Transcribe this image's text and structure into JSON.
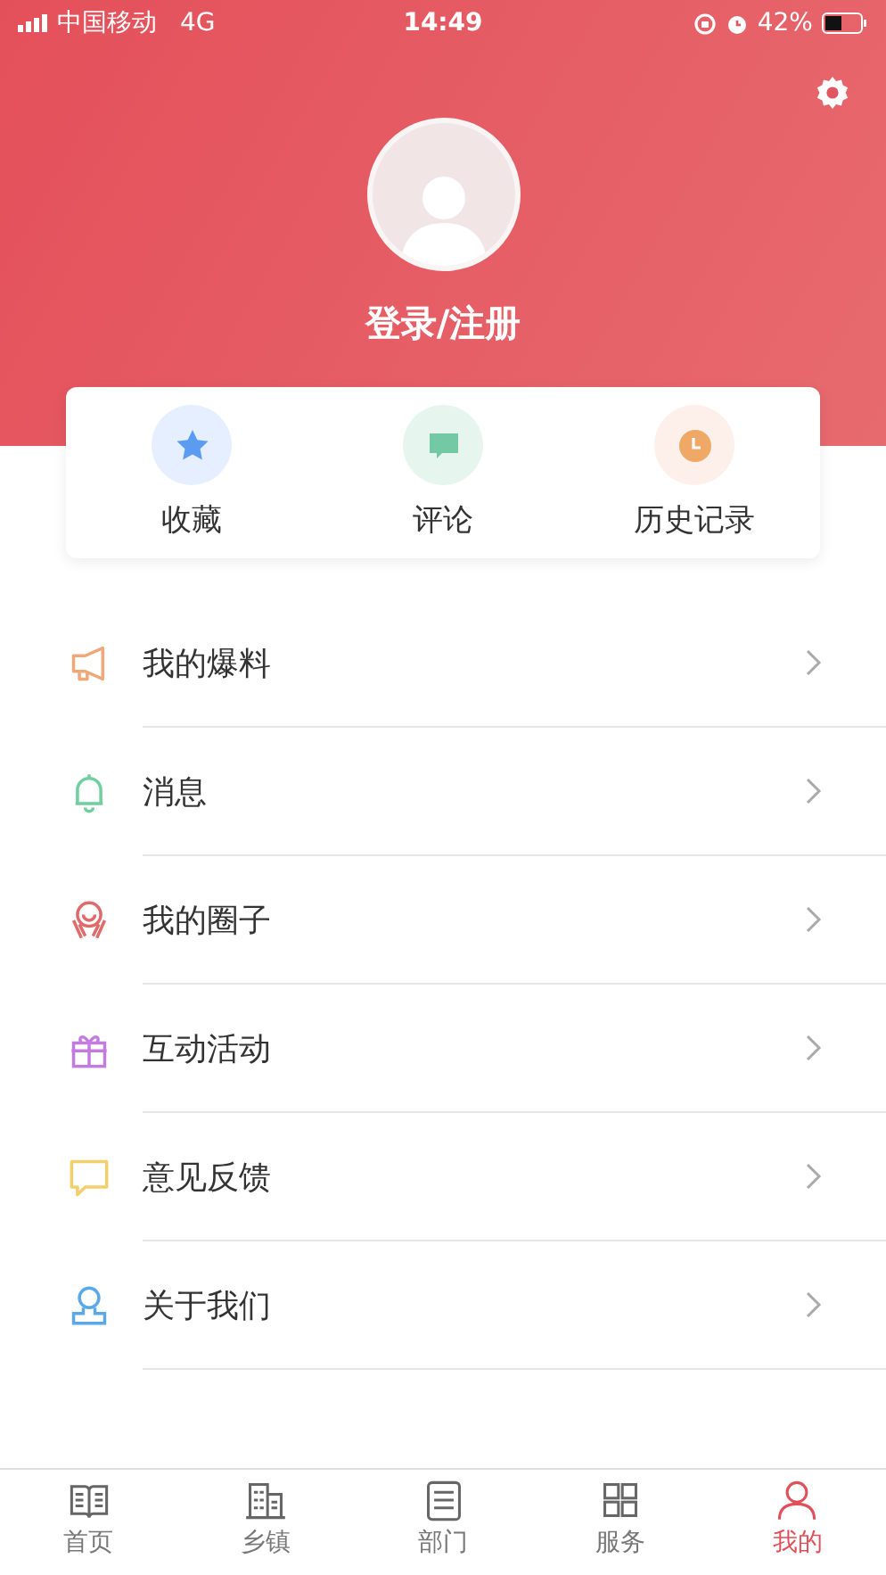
{
  "status_bar": {
    "carrier": "中国移动",
    "network": "4G",
    "time": "14:49",
    "battery": "42%"
  },
  "profile": {
    "login_label": "登录/注册"
  },
  "quick_actions": [
    {
      "label": "收藏",
      "kind": "star",
      "color": "#5b9cf2"
    },
    {
      "label": "评论",
      "kind": "comment",
      "color": "#72c9a4"
    },
    {
      "label": "历史记录",
      "kind": "clock",
      "color": "#f0a866"
    }
  ],
  "menu": [
    {
      "label": "我的爆料",
      "kind": "megaphone",
      "color": "#f0a878"
    },
    {
      "label": "消息",
      "kind": "bell",
      "color": "#6fcf9f"
    },
    {
      "label": "我的圈子",
      "kind": "circle",
      "color": "#e06a6a"
    },
    {
      "label": "互动活动",
      "kind": "gift",
      "color": "#c47be0"
    },
    {
      "label": "意见反馈",
      "kind": "feedback",
      "color": "#f2cf6a"
    },
    {
      "label": "关于我们",
      "kind": "person",
      "color": "#5aa9e6"
    }
  ],
  "tabs": [
    {
      "label": "首页",
      "kind": "book",
      "selected": false
    },
    {
      "label": "乡镇",
      "kind": "building",
      "selected": false
    },
    {
      "label": "部门",
      "kind": "list",
      "selected": false
    },
    {
      "label": "服务",
      "kind": "grid",
      "selected": false
    },
    {
      "label": "我的",
      "kind": "user",
      "selected": true
    }
  ]
}
